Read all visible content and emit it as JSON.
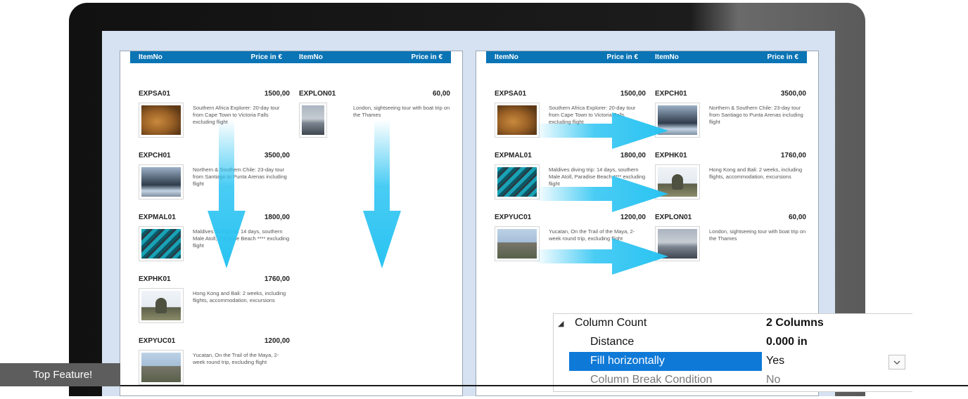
{
  "columns": {
    "item_no": "ItemNo",
    "price": "Price in €"
  },
  "items": {
    "EXPSA01": {
      "no": "EXPSA01",
      "price": "1500,00",
      "desc": "Southern Africa Explorer: 20-day tour from Cape Town to Victoria Falls excluding flight",
      "icon": "lion-photo"
    },
    "EXPCH01": {
      "no": "EXPCH01",
      "price": "3500,00",
      "desc": "Northern & Southern Chile: 23-day tour from Santiago to Punta Arenas including flight",
      "icon": "mountain-river-photo"
    },
    "EXPMAL01": {
      "no": "EXPMAL01",
      "price": "1800,00",
      "desc": "Maldives diving trip: 14 days, southern Male Atoll, Paradise Beach **** excluding flight",
      "icon": "fish-photo"
    },
    "EXPHK01": {
      "no": "EXPHK01",
      "price": "1760,00",
      "desc": "Hong Kong and Bali: 2 weeks, including flights, accommodation, excursions",
      "icon": "buddha-statue-photo"
    },
    "EXPYUC01": {
      "no": "EXPYUC01",
      "price": "1200,00",
      "desc": "Yucatan, On the Trail of the Maya, 2-week round trip, excluding flight",
      "icon": "pyramid-photo"
    },
    "EXPLON01": {
      "no": "EXPLON01",
      "price": "60,00",
      "desc": "London, sightseeing tour with boat trip on the Thames",
      "icon": "thames-photo"
    }
  },
  "pages": {
    "vertical_fill": {
      "left_column": [
        "EXPSA01",
        "EXPCH01",
        "EXPMAL01",
        "EXPHK01",
        "EXPYUC01"
      ],
      "right_column": [
        "EXPLON01"
      ]
    },
    "horizontal_fill": {
      "left_column": [
        "EXPSA01",
        "EXPMAL01",
        "EXPYUC01"
      ],
      "right_column": [
        "EXPCH01",
        "EXPHK01",
        "EXPLON01"
      ]
    }
  },
  "properties": {
    "column_count": {
      "label": "Column Count",
      "value": "2 Columns"
    },
    "distance": {
      "label": "Distance",
      "value": "0.000 in"
    },
    "fill_horizontally": {
      "label": "Fill horizontally",
      "value": "Yes"
    },
    "column_break_condition": {
      "label": "Column Break Condition",
      "value": "No"
    }
  },
  "badge": {
    "label": "Top Feature!"
  },
  "colors": {
    "header_blue": "#0a74b5",
    "arrow_cyan": "#29c3f2",
    "selection_blue": "#0f79d7",
    "screen_bg": "#d6e2f1"
  }
}
